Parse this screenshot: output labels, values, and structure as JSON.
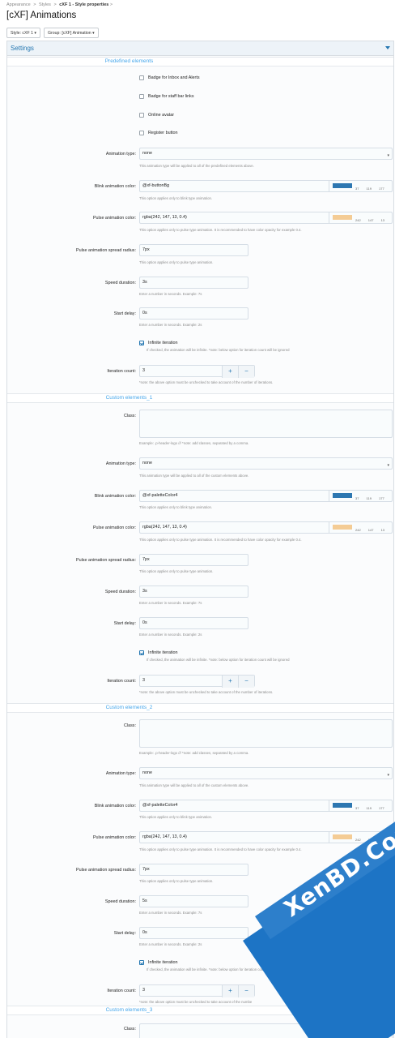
{
  "breadcrumb": {
    "items": [
      "Appearance",
      ">",
      "Styles",
      ">",
      "cXF 1 - Style properties",
      ">"
    ]
  },
  "page_title": "[cXF] Animations",
  "filters": {
    "style": "Style: cXF 1 ▾",
    "group": "Group: [cXF] Animation ▾"
  },
  "block_title": "Settings",
  "sections": [
    {
      "header": "Predefined elements",
      "checkboxes": [
        {
          "label": "Badge for Inbox and Alerts",
          "checked": false
        },
        {
          "label": "Badge for staff bar links",
          "checked": false
        },
        {
          "label": "Online avatar",
          "checked": false
        },
        {
          "label": "Register button",
          "checked": false
        }
      ],
      "animation_type": {
        "label": "Animation type:",
        "value": "none",
        "hint": "This animation type will be applied to all of the predefined elements above."
      },
      "blink_color": {
        "label": "Blink animation color:",
        "value": "@xf-buttonBg",
        "hint": "This option applies only to blink type animation.",
        "swatch": "#2d77b1",
        "rgb": "37 119 177"
      },
      "pulse_color": {
        "label": "Pulse animation color:",
        "value": "rgba(242, 147, 13, 0.4)",
        "hint": "This option applies only to pulse type animation. It is recommended to have color opacity for example 0.4.",
        "swatch": "#f4cc95",
        "rgb": "242 147 13"
      },
      "spread_radius": {
        "label": "Pulse animation spread radius:",
        "value": "7px",
        "hint": "This option applies only to pulse type animation."
      },
      "speed": {
        "label": "Speed duration:",
        "value": "3s",
        "hint": "Enter a number in seconds. Example: 7s"
      },
      "delay": {
        "label": "Start delay:",
        "value": "0s",
        "hint": "Enter a number in seconds. Example: 2s"
      },
      "infinite": {
        "label": "Infinite iteration",
        "checked": true,
        "hint": "If checked, the animation will be infinite. *note: below option for iteration count will be ignored"
      },
      "iteration": {
        "label": "Iteration count:",
        "value": "3",
        "plus": "+",
        "minus": "−",
        "hint": "*note: the above option must be unchecked to take account of the number of iterations."
      }
    },
    {
      "header": "Custom elements_1",
      "class": {
        "label": "Class:",
        "value": "",
        "hint": "Example: .p-header-logo /// *note: add classes, separated by a comma."
      },
      "animation_type": {
        "label": "Animation type:",
        "value": "none",
        "hint": "This animation type will be applied to all of the custom elements above."
      },
      "blink_color": {
        "label": "Blink animation color:",
        "value": "@xf-paletteColor4",
        "hint": "This option applies only to blink type animation.",
        "swatch": "#2d77b1",
        "rgb": "37 119 177"
      },
      "pulse_color": {
        "label": "Pulse animation color:",
        "value": "rgba(242, 147, 13, 0.4)",
        "hint": "This option applies only to pulse type animation. It is recommended to have color opacity for example 0.4.",
        "swatch": "#f4cc95",
        "rgb": "242 147 13"
      },
      "spread_radius": {
        "label": "Pulse animation spread radius:",
        "value": "7px",
        "hint": "This option applies only to pulse type animation."
      },
      "speed": {
        "label": "Speed duration:",
        "value": "3s",
        "hint": "Enter a number in seconds. Example: 7s"
      },
      "delay": {
        "label": "Start delay:",
        "value": "0s",
        "hint": "Enter a number in seconds. Example: 2s"
      },
      "infinite": {
        "label": "Infinite iteration",
        "checked": true,
        "hint": "If checked, the animation will be infinite. *note: below option for iteration count will be ignored"
      },
      "iteration": {
        "label": "Iteration count:",
        "value": "3",
        "plus": "+",
        "minus": "−",
        "hint": "*note: the above option must be unchecked to take account of the number of iterations."
      }
    },
    {
      "header": "Custom elements_2",
      "class": {
        "label": "Class:",
        "value": "",
        "hint": "Example: .p-header-logo /// *note: add classes, separated by a comma."
      },
      "animation_type": {
        "label": "Animation type:",
        "value": "none",
        "hint": "This animation type will be applied to all of the custom elements above."
      },
      "blink_color": {
        "label": "Blink animation color:",
        "value": "@xf-paletteColor4",
        "hint": "This option applies only to blink type animation.",
        "swatch": "#2d77b1",
        "rgb": "37 119 177"
      },
      "pulse_color": {
        "label": "Pulse animation color:",
        "value": "rgba(242, 147, 13, 0.4)",
        "hint": "This option applies only to pulse type animation. It is recommended to have color opacity for example 0.4.",
        "swatch": "#f4cc95",
        "rgb": "242 147 13"
      },
      "spread_radius": {
        "label": "Pulse animation spread radius:",
        "value": "7px",
        "hint": "This option applies only to pulse type animation."
      },
      "speed": {
        "label": "Speed duration:",
        "value": "5s",
        "hint": "Enter a number in seconds. Example: 7s"
      },
      "delay": {
        "label": "Start delay:",
        "value": "0s",
        "hint": "Enter a number in seconds. Example: 2s"
      },
      "infinite": {
        "label": "Infinite iteration",
        "checked": true,
        "hint": "If checked, the animation will be infinite. *note: below option for iteration count will"
      },
      "iteration": {
        "label": "Iteration count:",
        "value": "3",
        "plus": "+",
        "minus": "−",
        "hint": "*note: the above option must be unchecked to take account of the numbe"
      }
    },
    {
      "header": "Custom elements_3",
      "class": {
        "label": "Class:"
      }
    }
  ],
  "watermark": "XenBD.Com"
}
